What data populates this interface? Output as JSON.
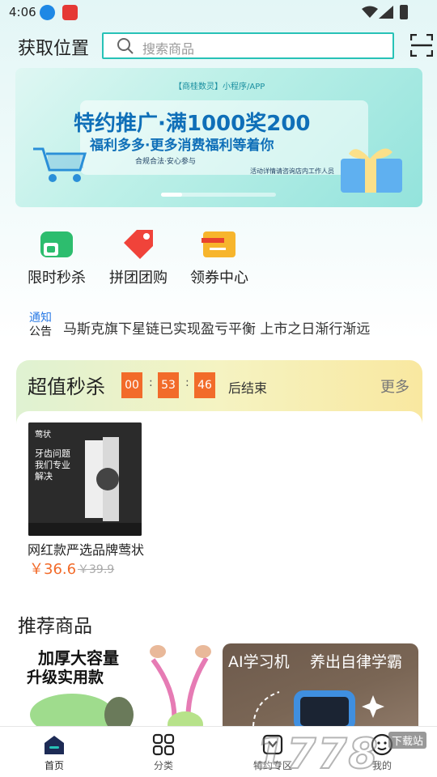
{
  "status_bar": {
    "time": "4:06"
  },
  "header": {
    "location_label": "获取位置",
    "search_placeholder": "搜索商品"
  },
  "banner": {
    "mini_program_label": "【商桂数灵】小程序/APP",
    "title": "特约推广·满1000奖200",
    "subtitle": "福利多多·更多消费福利等着你",
    "tagline": "合规合法·安心参与",
    "note": "活动详情请咨询店内工作人员",
    "active_slide": 1,
    "slide_count": 5
  },
  "quick_menu": [
    {
      "label": "限时秒杀",
      "icon": "flash-sale-icon",
      "color": "#2dbd6e"
    },
    {
      "label": "拼团团购",
      "icon": "group-buy-tag-icon",
      "color": "#f0433a"
    },
    {
      "label": "领券中心",
      "icon": "coupon-icon",
      "color": "#f7b52c"
    }
  ],
  "notice": {
    "badge_top": "通知",
    "badge_bottom": "公告",
    "text": "马斯克旗下星链已实现盈亏平衡 上市之日渐行渐远"
  },
  "flash_sale": {
    "title": "超值秒杀",
    "countdown": {
      "hours": "00",
      "minutes": "53",
      "seconds": "46"
    },
    "countdown_suffix": "后结束",
    "more_label": "更多",
    "product": {
      "name": "网红款严选品牌莺状牙膏",
      "price": "￥36.6",
      "original_price": "￥39.9",
      "image_lines": [
        "莺状",
        "牙齿问题",
        "我们专业",
        "解决"
      ]
    }
  },
  "recommended": {
    "title": "推荐商品",
    "cards": [
      {
        "line1": "加厚大容量",
        "line2": "升级实用款"
      },
      {
        "line1": "AI学习机",
        "line2": "养出自律学霸"
      }
    ]
  },
  "bottom_nav": [
    {
      "label": "首页",
      "icon": "home-icon",
      "active": true
    },
    {
      "label": "分类",
      "icon": "category-grid-icon",
      "active": false
    },
    {
      "label": "特约专区",
      "icon": "special-zone-icon",
      "active": false
    },
    {
      "label": "我的",
      "icon": "profile-icon",
      "active": false
    }
  ],
  "watermark": {
    "text": "1778",
    "tag": "下载站"
  },
  "colors": {
    "accent_teal": "#27c2b7",
    "price_orange": "#f26b2a",
    "countdown_bg": "#f26b2a"
  }
}
